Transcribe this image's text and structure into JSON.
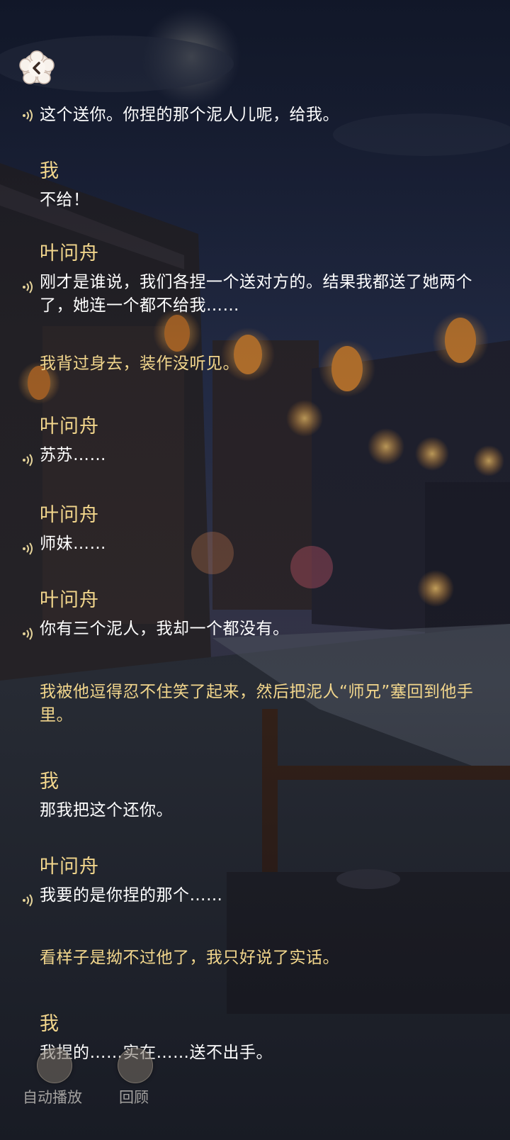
{
  "controls": {
    "auto_play": "自动播放",
    "review": "回顾"
  },
  "dialogue": [
    {
      "text": "这个送你。你捏的那个泥人儿呢，给我。",
      "voice": true
    },
    {
      "speaker": "我",
      "text": "不给！"
    },
    {
      "speaker": "叶问舟",
      "text": "刚才是谁说，我们各捏一个送对方的。结果我都送了她两个了，她连一个都不给我……",
      "voice": true
    },
    {
      "text": "我背过身去，装作没听见。",
      "narration": true
    },
    {
      "speaker": "叶问舟",
      "text": "苏苏……",
      "voice": true
    },
    {
      "speaker": "叶问舟",
      "text": "师妹……",
      "voice": true
    },
    {
      "speaker": "叶问舟",
      "text": "你有三个泥人，我却一个都没有。",
      "voice": true
    },
    {
      "text": "我被他逗得忍不住笑了起来，然后把泥人“师兄”塞回到他手里。",
      "narration": true
    },
    {
      "speaker": "我",
      "text": "那我把这个还你。"
    },
    {
      "speaker": "叶问舟",
      "text": "我要的是你捏的那个……",
      "voice": true
    },
    {
      "text": "看样子是拗不过他了，我只好说了实话。",
      "narration": true
    },
    {
      "speaker": "我",
      "text": "我捏的……实在……送不出手。"
    }
  ]
}
